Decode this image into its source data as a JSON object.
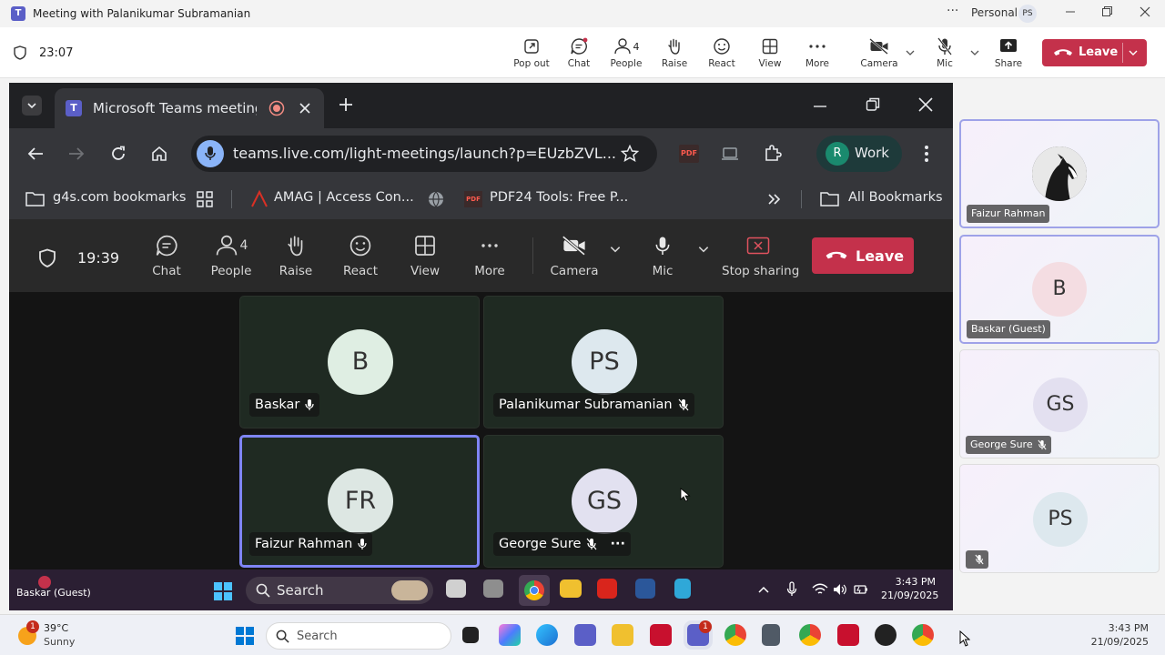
{
  "outer_window": {
    "title": "Meeting with Palanikumar Subramanian",
    "more_dots": "···",
    "profile_label": "Personal",
    "profile_initials": "PS"
  },
  "outer_toolbar": {
    "timer": "23:07",
    "buttons": [
      {
        "label": "Pop out",
        "icon": "pop-out-icon"
      },
      {
        "label": "Chat",
        "icon": "chat-icon"
      },
      {
        "label": "People",
        "icon": "people-icon",
        "count": "4"
      },
      {
        "label": "Raise",
        "icon": "raise-hand-icon"
      },
      {
        "label": "React",
        "icon": "react-icon"
      },
      {
        "label": "View",
        "icon": "view-icon"
      },
      {
        "label": "More",
        "icon": "more-icon"
      },
      {
        "label": "Camera",
        "icon": "camera-off-icon"
      },
      {
        "label": "Mic",
        "icon": "mic-off-icon"
      },
      {
        "label": "Share",
        "icon": "share-icon"
      }
    ],
    "leave_label": "Leave"
  },
  "browser": {
    "tab_title": "Microsoft Teams meeting | M",
    "url": "teams.live.com/light-meetings/launch?p=EUzbZVL...",
    "profile_initial": "R",
    "profile_name": "Work",
    "bookmarks": [
      "g4s.com bookmarks",
      "AMAG | Access Con...",
      "PDF24 Tools: Free P..."
    ],
    "all_bookmarks": "All Bookmarks",
    "pdf_ext_label": "PDF"
  },
  "inner_toolbar": {
    "timer": "19:39",
    "buttons": [
      {
        "label": "Chat"
      },
      {
        "label": "People",
        "count": "4"
      },
      {
        "label": "Raise"
      },
      {
        "label": "React"
      },
      {
        "label": "View"
      },
      {
        "label": "More"
      },
      {
        "label": "Camera"
      },
      {
        "label": "Mic"
      },
      {
        "label": "Stop sharing"
      }
    ],
    "leave_label": "Leave"
  },
  "stage_tiles": [
    {
      "initials": "B",
      "name": "Baskar",
      "mic": "mic-on",
      "avatar_color": "#dfeee3"
    },
    {
      "initials": "PS",
      "name": "Palanikumar Subramanian",
      "mic": "mic-off",
      "avatar_color": "#dde8ee"
    },
    {
      "initials": "FR",
      "name": "Faizur Rahman",
      "mic": "mic-on",
      "avatar_color": "#dde7e3",
      "active": true
    },
    {
      "initials": "GS",
      "name": "George Sure",
      "mic": "mic-off",
      "avatar_color": "#e2e1f0",
      "more": "···"
    }
  ],
  "inner_taskbar": {
    "search_label": "Search",
    "time": "3:43 PM",
    "date": "21/09/2025",
    "floating_label": "Baskar (Guest)"
  },
  "right_panel": [
    {
      "name": "Faizur Rahman",
      "avatar": "horse-photo",
      "selected": true
    },
    {
      "initials": "B",
      "name": "Baskar (Guest)",
      "avatar_color": "#f4dde2",
      "selected": true
    },
    {
      "initials": "GS",
      "name": "George Sure",
      "mic": "mic-off",
      "avatar_color": "#e3e0f0"
    },
    {
      "initials": "PS",
      "name": "",
      "mic": "mic-off",
      "avatar_color": "#dde8ee"
    }
  ],
  "outer_taskbar": {
    "weather_temp": "39°C",
    "weather_desc": "Sunny",
    "weather_badge": "1",
    "search_label": "Search",
    "teams_badge": "1",
    "time": "3:43 PM",
    "date": "21/09/2025"
  },
  "colors": {
    "leave_red": "#c4314b",
    "teams_purple": "#5b5fc7",
    "active_border": "#7f85f5"
  }
}
